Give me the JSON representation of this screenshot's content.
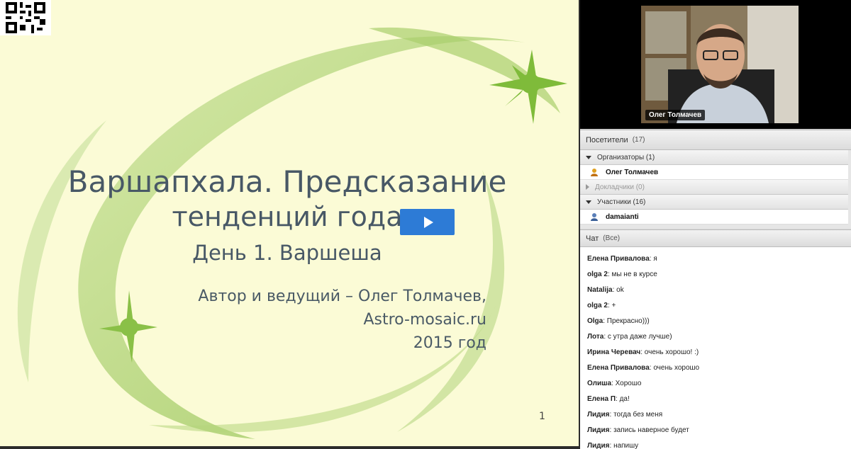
{
  "slide": {
    "title_line1": "Варшапхала. Предсказание",
    "title_line2": "тенденций года",
    "title_line3": "День 1. Варшеша",
    "author_line1": "Автор и ведущий – Олег Толмачев,",
    "author_line2": "Astro-mosaic.ru",
    "author_line3": "2015 год",
    "page_number": "1"
  },
  "video": {
    "presenter_name": "Олег Толмачев"
  },
  "attendees": {
    "title": "Посетители",
    "count": "(17)",
    "groups": [
      {
        "label": "Организаторы (1)",
        "expanded": true,
        "users": [
          "Олег Толмачев"
        ]
      },
      {
        "label": "Докладчики (0)",
        "expanded": false,
        "users": []
      },
      {
        "label": "Участники (16)",
        "expanded": true,
        "users": [
          "damaianti"
        ]
      }
    ]
  },
  "chat": {
    "title": "Чат",
    "scope": "(Все)",
    "messages": [
      {
        "author": "Елена Привалова",
        "text": "я"
      },
      {
        "author": "olga 2",
        "text": " мы не в курсе"
      },
      {
        "author": "Natalija",
        "text": "ok"
      },
      {
        "author": "olga 2",
        "text": "+"
      },
      {
        "author": "Olga",
        "text": "Прекрасно)))"
      },
      {
        "author": "Лота",
        "text": "с утра даже лучше)"
      },
      {
        "author": "Ирина Черевач",
        "text": "очень хорошо! :)"
      },
      {
        "author": "Елена Привалова",
        "text": "очень хорошо"
      },
      {
        "author": "Олиша",
        "text": "Хорошо"
      },
      {
        "author": "Елена П",
        "text": "да!"
      },
      {
        "author": "Лидия",
        "text": "тогда без меня"
      },
      {
        "author": "Лидия",
        "text": "запись наверное будет"
      },
      {
        "author": "Лидия",
        "text": "напишу"
      }
    ]
  },
  "colors": {
    "slide_bg": "#fbfbd6",
    "swoosh_green": "#9cc55a",
    "play_blue": "#2d7bd6"
  }
}
